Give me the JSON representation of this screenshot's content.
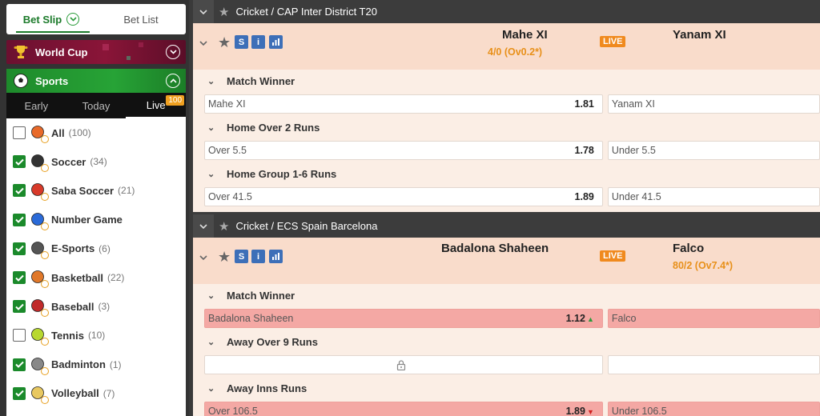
{
  "sidebar": {
    "slip_tabs": {
      "bet_slip": "Bet Slip",
      "bet_list": "Bet List"
    },
    "world_cup": "World Cup",
    "sports_header": "Sports",
    "mode_tabs": {
      "early": "Early",
      "today": "Today",
      "live": "Live",
      "live_count": "100"
    },
    "sports": [
      {
        "name": "All",
        "count": "(100)",
        "checked": false,
        "icon": "all-sports-icon"
      },
      {
        "name": "Soccer",
        "count": "(34)",
        "checked": true,
        "icon": "soccer-ball-icon"
      },
      {
        "name": "Saba Soccer",
        "count": "(21)",
        "checked": true,
        "icon": "saba-soccer-icon"
      },
      {
        "name": "Number Game",
        "count": "",
        "checked": true,
        "icon": "number-game-icon"
      },
      {
        "name": "E-Sports",
        "count": "(6)",
        "checked": true,
        "icon": "headset-icon"
      },
      {
        "name": "Basketball",
        "count": "(22)",
        "checked": true,
        "icon": "basketball-icon"
      },
      {
        "name": "Baseball",
        "count": "(3)",
        "checked": true,
        "icon": "baseball-icon"
      },
      {
        "name": "Tennis",
        "count": "(10)",
        "checked": false,
        "icon": "tennis-ball-icon"
      },
      {
        "name": "Badminton",
        "count": "(1)",
        "checked": true,
        "icon": "shuttlecock-icon"
      },
      {
        "name": "Volleyball",
        "count": "(7)",
        "checked": true,
        "icon": "volleyball-icon"
      }
    ]
  },
  "colors": {
    "accent_green": "#1b8a2b",
    "live_orange": "#f08a1e",
    "header_peach": "#f9dccb",
    "market_bg": "#fbeee5"
  },
  "leagues": [
    {
      "title": "Cricket / CAP Inter District T20",
      "match": {
        "home": "Mahe XI",
        "home_score": "4/0 (Ov0.2*)",
        "away": "Yanam XI",
        "away_score": "",
        "live": "LIVE",
        "markets": [
          {
            "name": "Match Winner",
            "left_label": "Mahe XI",
            "left_price": "1.81",
            "right_label": "Yanam XI",
            "right_price": ""
          },
          {
            "name": "Home Over 2 Runs",
            "left_label": "Over 5.5",
            "left_price": "1.78",
            "right_label": "Under 5.5",
            "right_price": ""
          },
          {
            "name": "Home Group 1-6 Runs",
            "left_label": "Over 41.5",
            "left_price": "1.89",
            "right_label": "Under 41.5",
            "right_price": ""
          }
        ]
      }
    },
    {
      "title": "Cricket / ECS Spain Barcelona",
      "match": {
        "home": "Badalona Shaheen",
        "home_score": "",
        "away": "Falco",
        "away_score": "80/2 (Ov7.4*)",
        "live": "LIVE",
        "markets": [
          {
            "name": "Match Winner",
            "left_label": "Badalona Shaheen",
            "left_price": "1.12",
            "right_label": "Falco",
            "right_price": ""
          },
          {
            "name": "Away Over 9 Runs",
            "left_label": "",
            "left_price": "",
            "right_label": "",
            "right_price": ""
          },
          {
            "name": "Away Inns Runs",
            "left_label": "Over 106.5",
            "left_price": "1.89",
            "right_label": "Under 106.5",
            "right_price": ""
          }
        ]
      }
    }
  ]
}
